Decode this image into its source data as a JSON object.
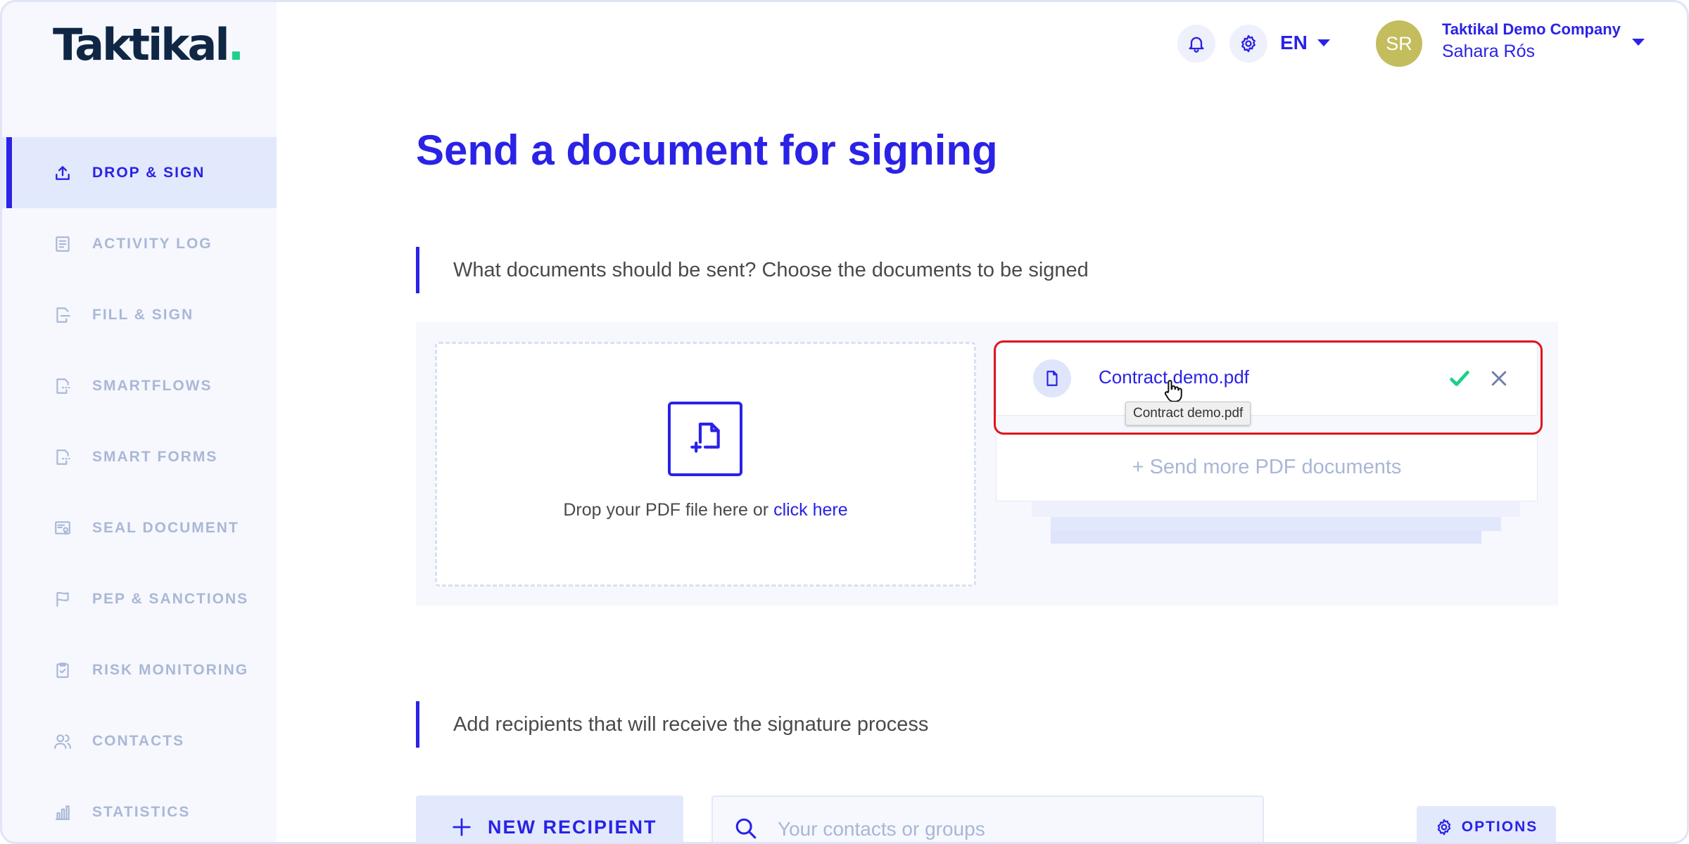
{
  "app": {
    "logo_text": "Taktikal",
    "logo_dot": "."
  },
  "colors": {
    "accent": "#2a22e6",
    "nav_inactive": "#aab8d6",
    "success": "#1fcf8a",
    "highlight": "#e0151e"
  },
  "sidebar": {
    "items": [
      {
        "label": "DROP & SIGN",
        "icon": "upload-icon",
        "active": true
      },
      {
        "label": "ACTIVITY LOG",
        "icon": "list-icon",
        "active": false
      },
      {
        "label": "FILL & SIGN",
        "icon": "fill-document-icon",
        "active": false
      },
      {
        "label": "SMARTFLOWS",
        "icon": "smartflow-icon",
        "active": false
      },
      {
        "label": "SMART FORMS",
        "icon": "smart-form-icon",
        "active": false
      },
      {
        "label": "SEAL DOCUMENT",
        "icon": "seal-icon",
        "active": false
      },
      {
        "label": "PEP & SANCTIONS",
        "icon": "flag-icon",
        "active": false
      },
      {
        "label": "RISK MONITORING",
        "icon": "clipboard-check-icon",
        "active": false
      },
      {
        "label": "CONTACTS",
        "icon": "users-icon",
        "active": false
      },
      {
        "label": "STATISTICS",
        "icon": "bar-chart-icon",
        "active": false
      }
    ]
  },
  "header": {
    "language": "EN",
    "user": {
      "initials": "SR",
      "company": "Taktikal Demo Company",
      "name": "Sahara Rós"
    }
  },
  "main": {
    "title": "Send a document for signing",
    "documents_section": {
      "heading": "What documents should be sent? Choose the documents to be signed",
      "dropzone_text": "Drop your PDF file here or ",
      "dropzone_link": "click here",
      "file": {
        "name": "Contract demo.pdf",
        "tooltip": "Contract demo.pdf"
      },
      "send_more": "+ Send more PDF documents"
    },
    "recipients_section": {
      "heading": "Add recipients that will receive the signature process",
      "new_recipient": "NEW RECIPIENT",
      "search_placeholder": "Your contacts or groups",
      "options": "OPTIONS"
    }
  }
}
